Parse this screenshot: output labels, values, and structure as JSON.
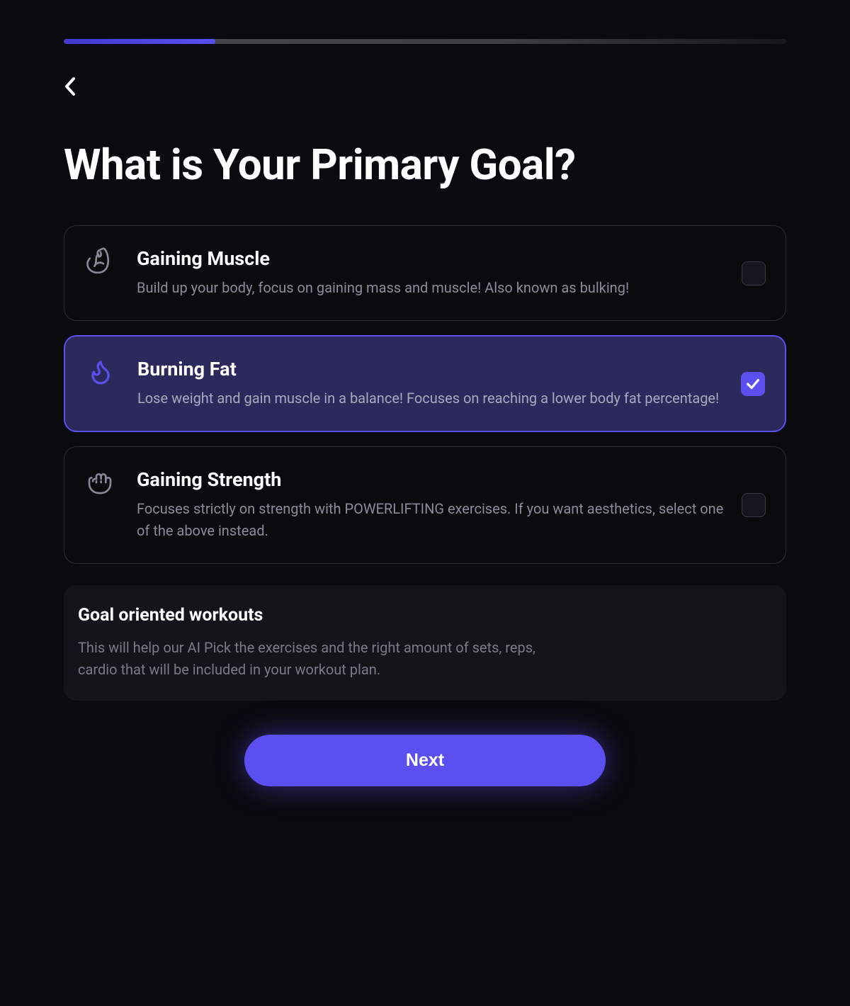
{
  "progress": {
    "percent": 21
  },
  "page": {
    "title": "What is Your Primary Goal?"
  },
  "options": [
    {
      "id": "gaining-muscle",
      "title": "Gaining Muscle",
      "description": "Build up your body, focus on gaining mass and muscle! Also known as bulking!",
      "selected": false,
      "icon": "biceps-icon"
    },
    {
      "id": "burning-fat",
      "title": "Burning Fat",
      "description": "Lose weight and gain muscle in a balance! Focuses on reaching a lower body fat percentage!",
      "selected": true,
      "icon": "flame-icon"
    },
    {
      "id": "gaining-strength",
      "title": "Gaining Strength",
      "description": "Focuses strictly on strength with POWERLIFTING exercises. If you want aesthetics, select one of the above instead.",
      "selected": false,
      "icon": "fist-icon"
    }
  ],
  "info": {
    "title": "Goal oriented workouts",
    "description": "This will help our AI Pick the exercises and the right amount of sets, reps, cardio that will be included in your workout plan."
  },
  "buttons": {
    "next": "Next"
  }
}
